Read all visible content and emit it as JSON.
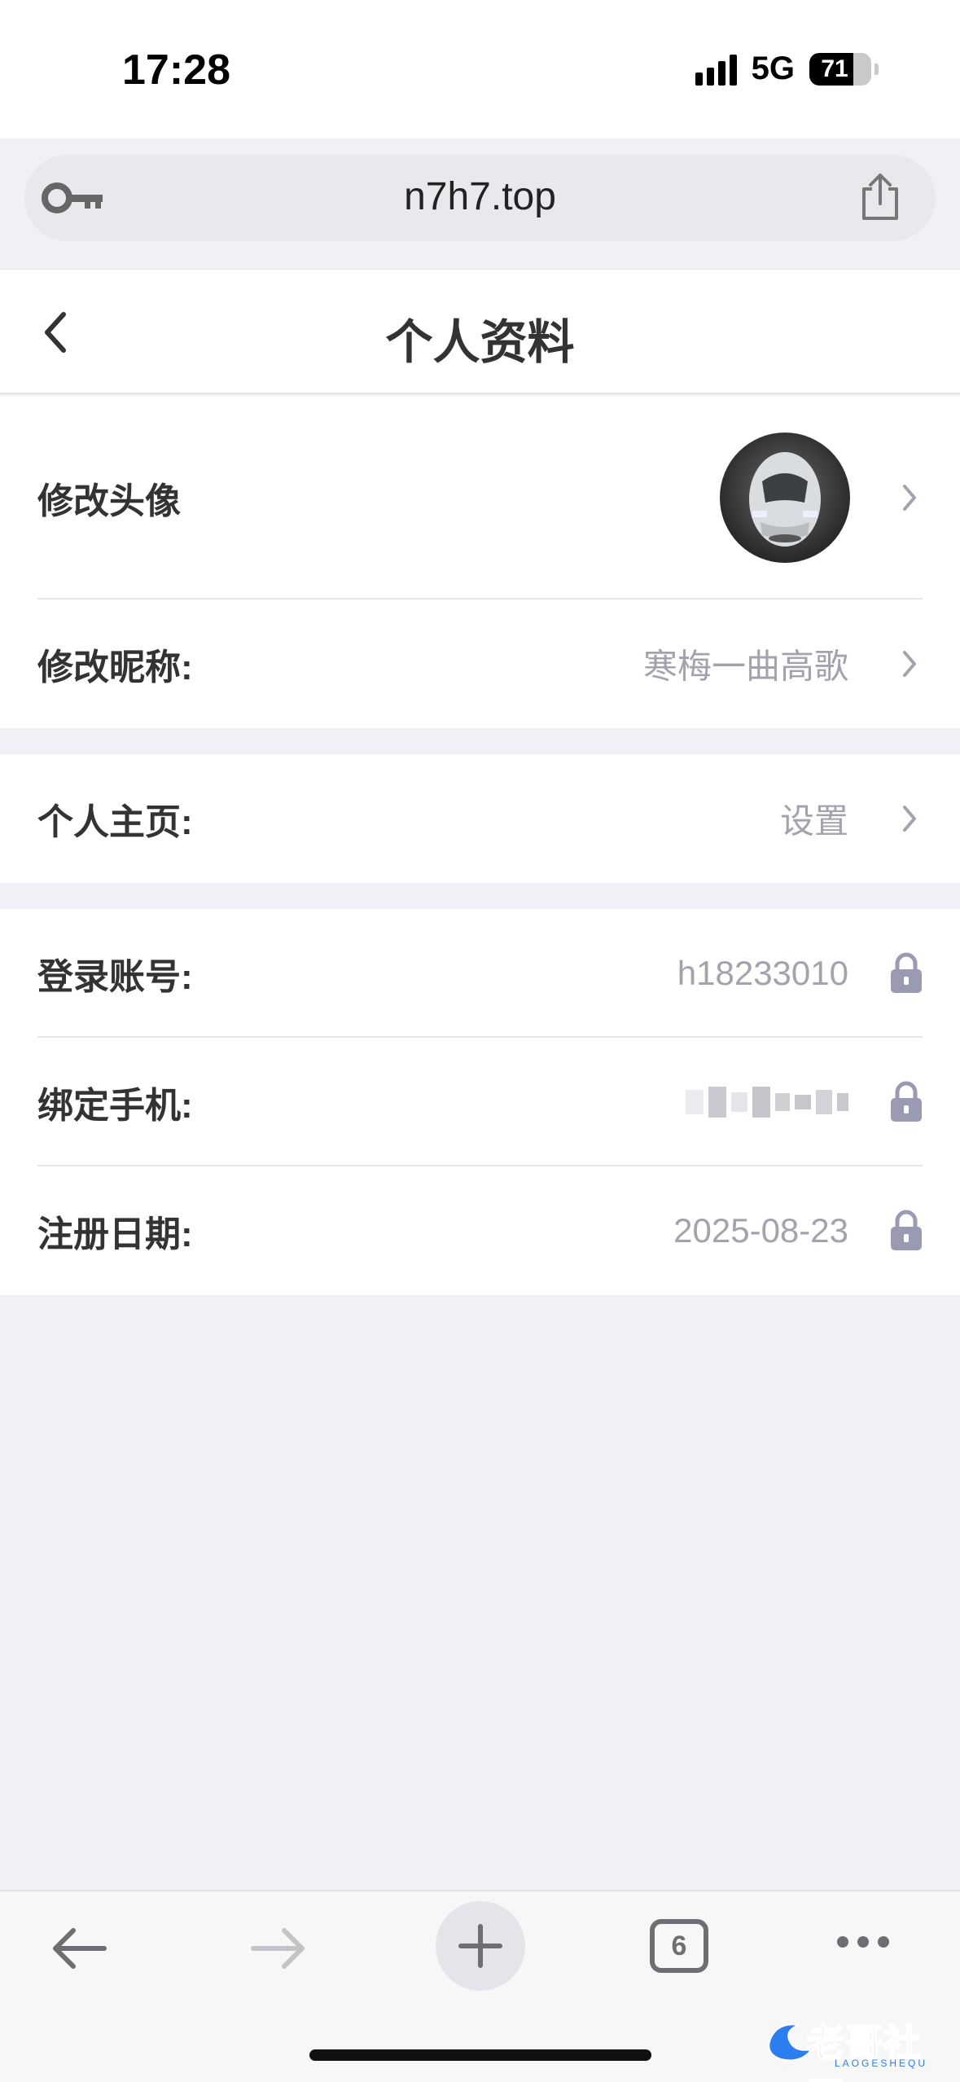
{
  "status_bar": {
    "time": "17:28",
    "network": "5G",
    "battery": "71",
    "battery_level": 0.71
  },
  "browser": {
    "url": "n7h7.top",
    "tabs_count": "6"
  },
  "header": {
    "title": "个人资料"
  },
  "groups": [
    {
      "rows": [
        {
          "label": "修改头像",
          "type": "avatar"
        },
        {
          "label": "修改昵称:",
          "value": "寒梅一曲高歌"
        }
      ]
    },
    {
      "rows": [
        {
          "label": "个人主页:",
          "value": "设置"
        }
      ]
    },
    {
      "rows": [
        {
          "label": "登录账号:",
          "value": "h18233010"
        },
        {
          "label": "绑定手机:",
          "value": ""
        },
        {
          "label": "注册日期:",
          "value": "2025-08-23"
        }
      ]
    }
  ],
  "watermark": {
    "text": "老哥社区",
    "sub": "LAOGESHEQU"
  },
  "colors": {
    "page_bg": "#f0f1f6",
    "value_text": "#a3a3ad",
    "lock": "#9a9bb3",
    "watermark": "#2b7ef0"
  }
}
